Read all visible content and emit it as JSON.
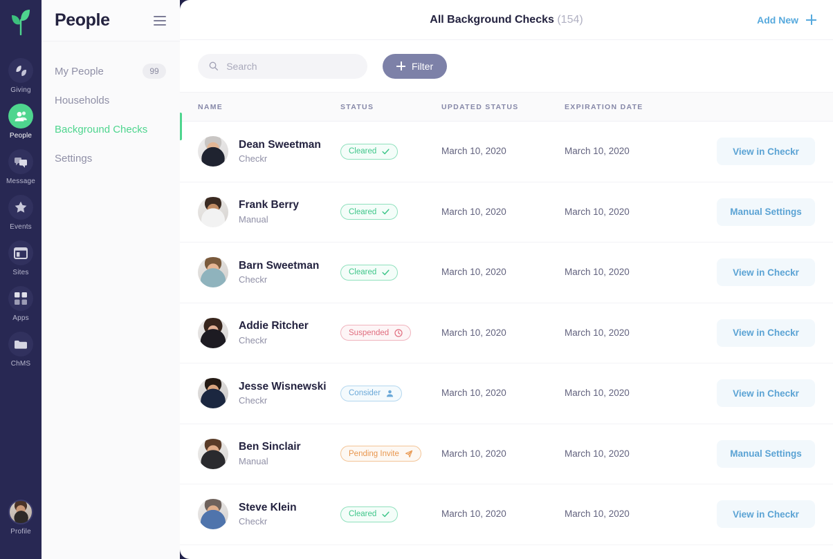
{
  "rail": {
    "logo_icon": "leaf-logo-icon",
    "items": [
      {
        "label": "Giving",
        "icon": "leaf-icon",
        "active": false
      },
      {
        "label": "People",
        "icon": "people-icon",
        "active": true
      },
      {
        "label": "Message",
        "icon": "chat-icon",
        "active": false
      },
      {
        "label": "Events",
        "icon": "star-icon",
        "active": false
      },
      {
        "label": "Sites",
        "icon": "browser-icon",
        "active": false
      },
      {
        "label": "Apps",
        "icon": "grid-icon",
        "active": false
      },
      {
        "label": "ChMS",
        "icon": "folder-icon",
        "active": false
      }
    ],
    "profile": {
      "label": "Profile",
      "icon": "profile-avatar"
    }
  },
  "nav": {
    "title": "People",
    "menu_icon": "hamburger-icon",
    "items": [
      {
        "label": "My People",
        "badge": "99",
        "active": false
      },
      {
        "label": "Households",
        "badge": null,
        "active": false
      },
      {
        "label": "Background Checks",
        "badge": null,
        "active": true
      },
      {
        "label": "Settings",
        "badge": null,
        "active": false
      }
    ]
  },
  "header": {
    "title": "All Background Checks",
    "count": "(154)",
    "add_new_label": "Add New",
    "add_new_icon": "plus-icon"
  },
  "toolbar": {
    "search_placeholder": "Search",
    "search_value": "",
    "search_icon": "search-icon",
    "filter_label": "Filter",
    "filter_icon": "plus-icon"
  },
  "table": {
    "columns": [
      "NAME",
      "STATUS",
      "UPDATED STATUS",
      "EXPIRATION DATE"
    ],
    "rows": [
      {
        "name": "Dean Sweetman",
        "source": "Checkr",
        "status": "Cleared",
        "status_kind": "cleared",
        "status_icon": "check-icon",
        "updated": "March 10, 2020",
        "expiration": "March 10, 2020",
        "action": "View in Checkr"
      },
      {
        "name": "Frank Berry",
        "source": "Manual",
        "status": "Cleared",
        "status_kind": "cleared",
        "status_icon": "check-icon",
        "updated": "March 10, 2020",
        "expiration": "March 10, 2020",
        "action": "Manual Settings"
      },
      {
        "name": "Barn Sweetman",
        "source": "Checkr",
        "status": "Cleared",
        "status_kind": "cleared",
        "status_icon": "check-icon",
        "updated": "March 10, 2020",
        "expiration": "March 10, 2020",
        "action": "View in Checkr"
      },
      {
        "name": "Addie Ritcher",
        "source": "Checkr",
        "status": "Suspended",
        "status_kind": "suspended",
        "status_icon": "clock-icon",
        "updated": "March 10, 2020",
        "expiration": "March 10, 2020",
        "action": "View in Checkr"
      },
      {
        "name": "Jesse Wisnewski",
        "source": "Checkr",
        "status": "Consider",
        "status_kind": "consider",
        "status_icon": "person-icon",
        "updated": "March 10, 2020",
        "expiration": "March 10, 2020",
        "action": "View in Checkr"
      },
      {
        "name": "Ben Sinclair",
        "source": "Manual",
        "status": "Pending Invite",
        "status_kind": "pending",
        "status_icon": "send-icon",
        "updated": "March 10, 2020",
        "expiration": "March 10, 2020",
        "action": "Manual Settings"
      },
      {
        "name": "Steve Klein",
        "source": "Checkr",
        "status": "Cleared",
        "status_kind": "cleared",
        "status_icon": "check-icon",
        "updated": "March 10, 2020",
        "expiration": "March 10, 2020",
        "action": "View in Checkr"
      }
    ]
  },
  "colors": {
    "rail_bg": "#282853",
    "page_bg": "#21214a",
    "accent_green": "#4ED58E",
    "link_blue": "#56a9dd",
    "filter_slate": "#7d81a8",
    "cleared": "#3fc68a",
    "suspended": "#e06c7e",
    "consider": "#6aa8d8",
    "pending": "#e8964d"
  }
}
